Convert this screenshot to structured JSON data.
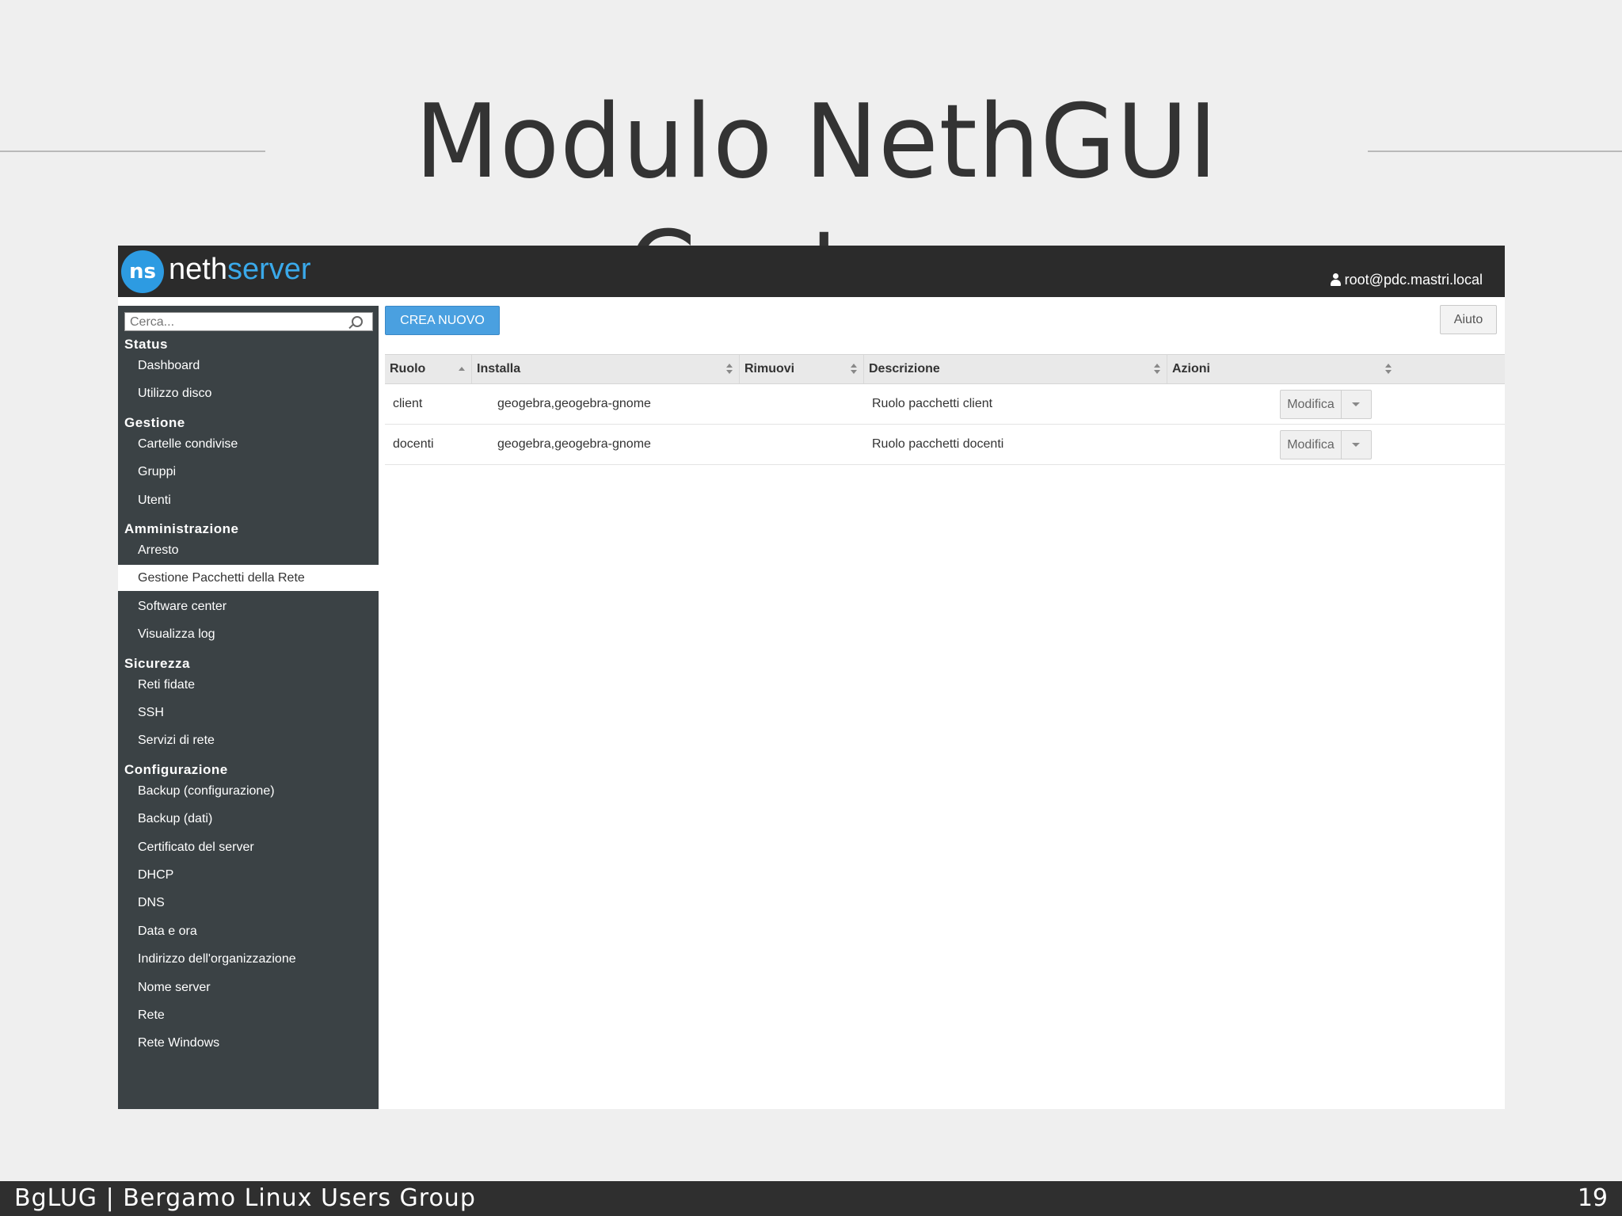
{
  "slide": {
    "title": "Modulo NethGUI Custom",
    "footer": "BgLUG | Bergamo Linux Users Group",
    "page_number": "19"
  },
  "app": {
    "logo_mark": "ns",
    "brand_part1": "neth",
    "brand_part2": "server",
    "user": "root@pdc.mastri.local"
  },
  "search": {
    "placeholder": "Cerca..."
  },
  "sidebar": {
    "groups": [
      {
        "label": "Status",
        "items": [
          "Dashboard",
          "Utilizzo disco"
        ]
      },
      {
        "label": "Gestione",
        "items": [
          "Cartelle condivise",
          "Gruppi",
          "Utenti"
        ]
      },
      {
        "label": "Amministrazione",
        "items": [
          "Arresto",
          "Gestione Pacchetti della Rete",
          "Software center",
          "Visualizza log"
        ]
      },
      {
        "label": "Sicurezza",
        "items": [
          "Reti fidate",
          "SSH",
          "Servizi di rete"
        ]
      },
      {
        "label": "Configurazione",
        "items": [
          "Backup (configurazione)",
          "Backup (dati)",
          "Certificato del server",
          "DHCP",
          "DNS",
          "Data e ora",
          "Indirizzo dell'organizzazione",
          "Nome server",
          "Rete",
          "Rete Windows"
        ]
      }
    ],
    "active_item": "Gestione Pacchetti della Rete"
  },
  "toolbar": {
    "create_label": "CREA NUOVO",
    "help_label": "Aiuto"
  },
  "table": {
    "columns": [
      "Ruolo",
      "Installa",
      "Rimuovi",
      "Descrizione",
      "Azioni"
    ],
    "rows": [
      {
        "ruolo": "client",
        "installa": "geogebra,geogebra-gnome",
        "rimuovi": "",
        "descrizione": "Ruolo pacchetti client",
        "azione": "Modifica"
      },
      {
        "ruolo": "docenti",
        "installa": "geogebra,geogebra-gnome",
        "rimuovi": "",
        "descrizione": "Ruolo pacchetti docenti",
        "azione": "Modifica"
      }
    ]
  },
  "colors": {
    "accent": "#4aa0e0",
    "topbar": "#2b2b2b",
    "sidebar": "#3b4245"
  }
}
